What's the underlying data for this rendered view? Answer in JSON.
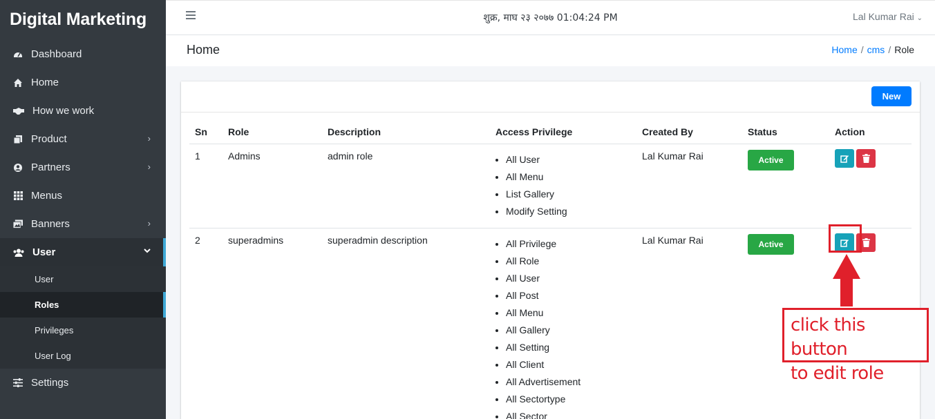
{
  "sidebar": {
    "brand": "Digital Marketing",
    "items": [
      {
        "label": "Dashboard",
        "icon": "dashboard-icon"
      },
      {
        "label": "Home",
        "icon": "home-icon"
      },
      {
        "label": "How we work",
        "icon": "handshake-icon"
      },
      {
        "label": "Product",
        "icon": "copy-icon",
        "has_children": true
      },
      {
        "label": "Partners",
        "icon": "user-circle-icon",
        "has_children": true
      },
      {
        "label": "Menus",
        "icon": "grid-icon"
      },
      {
        "label": "Banners",
        "icon": "images-icon",
        "has_children": true
      },
      {
        "label": "User",
        "icon": "users-icon",
        "expanded": true
      }
    ],
    "user_subitems": [
      "User",
      "Roles",
      "Privileges",
      "User Log"
    ],
    "active_subitem": "Roles",
    "settings_label": "Settings"
  },
  "topbar": {
    "datetime": "शुक्र, माघ २३ २०७७ 01:04:24 PM",
    "user_name": "Lal Kumar Rai",
    "user_caret": "⌄"
  },
  "header": {
    "title": "Home",
    "breadcrumb": [
      "Home",
      "cms",
      "Role"
    ]
  },
  "card": {
    "new_button": "New"
  },
  "table": {
    "columns": [
      "Sn",
      "Role",
      "Description",
      "Access Privilege",
      "Created By",
      "Status",
      "Action"
    ],
    "rows": [
      {
        "sn": "1",
        "role": "Admins",
        "description": "admin role",
        "privileges": [
          "All User",
          "All Menu",
          "List Gallery",
          "Modify Setting"
        ],
        "created_by": "Lal Kumar Rai",
        "status": "Active"
      },
      {
        "sn": "2",
        "role": "superadmins",
        "description": "superadmin description",
        "privileges": [
          "All Privilege",
          "All Role",
          "All User",
          "All Post",
          "All Menu",
          "All Gallery",
          "All Setting",
          "All Client",
          "All Advertisement",
          "All Sectortype",
          "All Sector"
        ],
        "created_by": "Lal Kumar Rai",
        "status": "Active"
      }
    ]
  },
  "annotation": {
    "callout_line1": "click this button",
    "callout_line2": "to edit role"
  },
  "colors": {
    "sidebar_bg": "#343a40",
    "primary": "#007bff",
    "success": "#28a745",
    "info": "#17a2b8",
    "danger": "#dc3545",
    "annotation_red": "#e0202b"
  }
}
